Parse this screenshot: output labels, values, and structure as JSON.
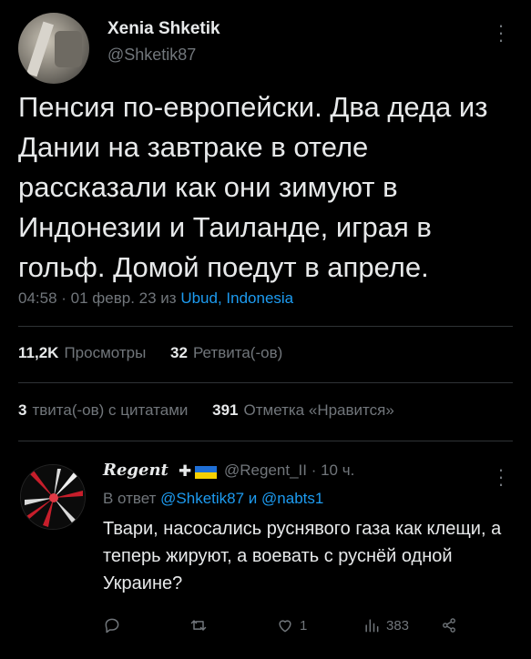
{
  "tweet": {
    "author_name": "Xenia Shketik",
    "author_handle": "@Shketik87",
    "text": "Пенсия по-европейски. Два деда из Дании на завтраке в отеле рассказали как они зимуют в Индонезии и Таиланде, играя в гольф. Домой поедут в апреле.",
    "time": "04:58 · 01 февр. 23 из ",
    "location": "Ubud, Indonesia",
    "views_count": "11,2K",
    "views_label": "Просмотры",
    "retweets_count": "32",
    "retweets_label": "Ретвита(-ов)",
    "quotes_count": "3",
    "quotes_label": "твита(-ов) с цитатами",
    "likes_count": "391",
    "likes_label": "Отметка «Нравится»"
  },
  "reply": {
    "author_name": "Regent",
    "cross": "✚",
    "handle_time": "@Regent_II · 10 ч.",
    "reply_to_prefix": "В ответ ",
    "reply_to_mentions": "@Shketik87 и @nabts1",
    "text": "Твари, насосались руснявого газа как клещи, а теперь жируют, а воевать с руснёй одной Украине?",
    "retweets": "",
    "likes": "1",
    "views": "383"
  },
  "icons": {
    "more": "more-icon",
    "reply": "reply-icon",
    "retweet": "retweet-icon",
    "like": "heart-icon",
    "views": "views-icon",
    "share": "share-icon"
  },
  "colors": {
    "background": "#000000",
    "text": "#e7e9ea",
    "secondary": "#71767b",
    "link": "#1d9bf0",
    "flag_blue": "#1f6fd6",
    "flag_yellow": "#f5d000"
  }
}
